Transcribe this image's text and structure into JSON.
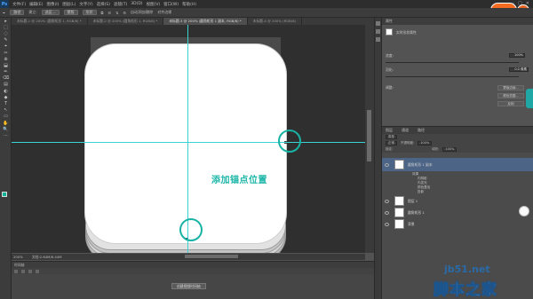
{
  "menubar": {
    "logo": "Ps",
    "menus": [
      "文件(F)",
      "编辑(E)",
      "图像(I)",
      "图层(L)",
      "文字(Y)",
      "选择(S)",
      "滤镜(T)",
      "3D(D)",
      "视图(V)",
      "窗口(W)",
      "帮助(H)"
    ],
    "winctl": [
      "—",
      "□",
      "✕"
    ]
  },
  "logo_badge": "jb51",
  "optbar": {
    "mode": "路径",
    "make": "建立:",
    "selection": "选区...",
    "mask": "蒙版",
    "shape": "形状",
    "auto": "自动添加/删除",
    "align": "对齐边缘"
  },
  "tabs": [
    {
      "label": "未标题-1 @ 200% (圆角矩形 1, RGB/8) *",
      "active": false
    },
    {
      "label": "未标题-2 @ 200% (圆角矩形 1, RGB/8) *",
      "active": false
    },
    {
      "label": "未标题-3 @ 200% (圆角矩形 1 副本, RGB/8) *",
      "active": true
    },
    {
      "label": "未标题-4 @ 200% (RGB/8)",
      "active": false
    }
  ],
  "tools": [
    "▸",
    "⬚",
    "◌",
    "✎",
    "⌖",
    "✂",
    "⊕",
    "⬓",
    "✏",
    "⌫",
    "▤",
    "◐",
    "◆",
    "T",
    "↖",
    "▭",
    "✋",
    "🔍",
    "⋯"
  ],
  "canvas": {
    "annotation": "添加锚点位置"
  },
  "statusbar": {
    "zoom": "200%",
    "doc": "文档:2.64M/6.44M"
  },
  "timeline": {
    "title": "时间轴",
    "button": "创建视频时间轴"
  },
  "properties": {
    "title": "属性",
    "subtitle": "实时形状属性",
    "density_label": "浓度:",
    "density_value": "100%",
    "feather_label": "羽化:",
    "feather_value": "0.0 像素",
    "refine_label": "调整:",
    "btn_edge": "蒙版边缘...",
    "btn_color": "颜色范围...",
    "btn_invert": "反相"
  },
  "layers": {
    "tabs": [
      "图层",
      "通道",
      "路径"
    ],
    "filter": "类型",
    "blend": "正常",
    "opacity_label": "不透明度:",
    "opacity_value": "100%",
    "lock_label": "锁定:",
    "fill_label": "填充:",
    "fill_value": "100%",
    "rows": [
      {
        "name": "圆角矩形 1 副本",
        "selected": true
      },
      {
        "name": "图层 1",
        "selected": false
      },
      {
        "name": "圆角矩形 1",
        "selected": false
      },
      {
        "name": "背景",
        "selected": false
      }
    ],
    "effects": [
      "效果",
      "内阴影",
      "内发光",
      "颜色叠加",
      "投影"
    ]
  },
  "watermark": {
    "site": "jb51.net",
    "brand": "脚本之家"
  }
}
